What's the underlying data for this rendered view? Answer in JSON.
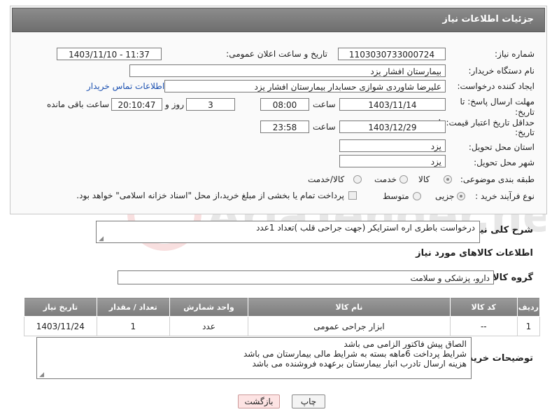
{
  "header": {
    "title": "جزئیات اطلاعات نیاز"
  },
  "form": {
    "need_number": {
      "label": "شماره نیاز:",
      "value": "1103030733000724"
    },
    "announce_datetime": {
      "label": "تاریخ و ساعت اعلان عمومی:",
      "value": "1403/11/10 - 11:37"
    },
    "buyer_org": {
      "label": "نام دستگاه خریدار:",
      "value": "بیمارستان افشار یزد"
    },
    "requester": {
      "label": "ایجاد کننده درخواست:",
      "value": "علیرضا شاوردی شوازی حسابدار بیمارستان افشار یزد",
      "contact_link": "اطلاعات تماس خریدار"
    },
    "deadline": {
      "label_line1": "مهلت ارسال پاسخ: تا",
      "label_line2": "تاریخ:",
      "date": "1403/11/14",
      "time_label": "ساعت",
      "time": "08:00",
      "days": "3",
      "days_label": "روز و",
      "remaining": "20:10:47",
      "remaining_label": "ساعت باقی مانده"
    },
    "price_validity": {
      "label_line1": "حداقل تاریخ اعتبار قیمت: تا",
      "label_line2": "تاریخ:",
      "date": "1403/12/29",
      "time_label": "ساعت",
      "time": "23:58"
    },
    "province": {
      "label": "استان محل تحویل:",
      "value": "یزد"
    },
    "city": {
      "label": "شهر محل تحویل:",
      "value": "یزد"
    },
    "category": {
      "label": "طبقه بندی موضوعی:",
      "options": [
        "کالا",
        "خدمت",
        "کالا/خدمت"
      ],
      "selected": "کالا"
    },
    "process_type": {
      "label": "نوع فرآیند خرید :",
      "options": [
        "جزیی",
        "متوسط"
      ],
      "selected": "جزیی",
      "payment_note": "پرداخت تمام یا بخشی از مبلغ خرید،از محل \"اسناد خزانه اسلامی\" خواهد بود."
    }
  },
  "description": {
    "label": "شرح کلی نیاز:",
    "value": "درخواست باطری اره استرایکر  (جهت جراحی قلب )تعداد 1عدد"
  },
  "goods_section": {
    "title": "اطلاعات کالاهای مورد نیاز",
    "group_label": "گروه کالا:",
    "group_value": "دارو، پزشکی و سلامت"
  },
  "table": {
    "headers": [
      "ردیف",
      "کد کالا",
      "نام کالا",
      "واحد شمارش",
      "تعداد / مقدار",
      "تاریخ نیاز"
    ],
    "rows": [
      [
        "1",
        "--",
        "ابزار جراحی عمومی",
        "عدد",
        "1",
        "1403/11/24"
      ]
    ]
  },
  "buyer_notes": {
    "label": "توضیحات خریدار:",
    "lines": [
      "الصاق پیش فاکتور الزامی می باشد",
      "شرایط پرداخت 6ماهه بسته به شرایط مالی بیمارستان می باشد",
      "هزینه ارسال تادرب انبار بیمارستان برعهده فروشنده می باشد"
    ]
  },
  "buttons": {
    "print": "چاپ",
    "back": "بازگشت"
  },
  "watermark": "AriaTender.net"
}
